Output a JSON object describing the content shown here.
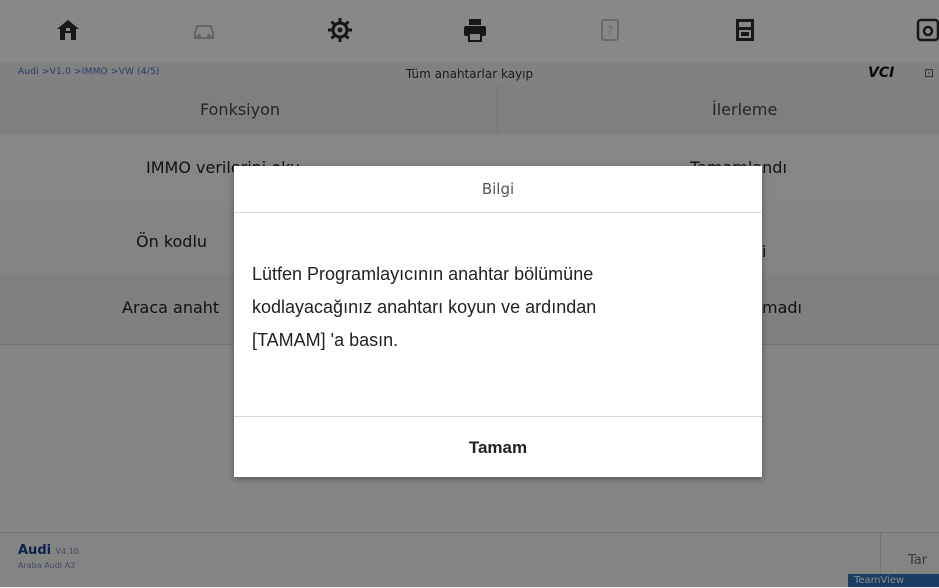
{
  "toolbar": {
    "icons": [
      "home-icon",
      "car-icon",
      "gear-icon",
      "printer-icon",
      "help-icon",
      "save-icon",
      "screenshot-icon"
    ]
  },
  "breadcrumb": {
    "vehicle_path": "Audi >V1.0 >IMMO >VW (4/5)",
    "current_function": "Tüm anahtarlar kayıp",
    "vci_label": "VCI",
    "extra": "⊡"
  },
  "table": {
    "headers": [
      "Fonksiyon",
      "İlerleme"
    ],
    "rows": [
      {
        "function": "IMMO verilerini oku",
        "status": "Tamamlandı"
      },
      {
        "function": "Ön kodlu",
        "status": "i"
      },
      {
        "function": "Araca anaht",
        "status": "madı"
      }
    ]
  },
  "footer": {
    "brand": "Audi",
    "brand_version": "V4.10",
    "sub": "Araba Audi A3",
    "right_label": "Tar",
    "chip": "TeamView"
  },
  "dialog": {
    "title": "Bilgi",
    "message_line1": "Lütfen Programlayıcının anahtar bölümüne",
    "message_line2": "kodlayacağınız anahtarı koyun ve ardından",
    "message_line3": "[TAMAM] 'a basın.",
    "ok_label": "Tamam"
  }
}
